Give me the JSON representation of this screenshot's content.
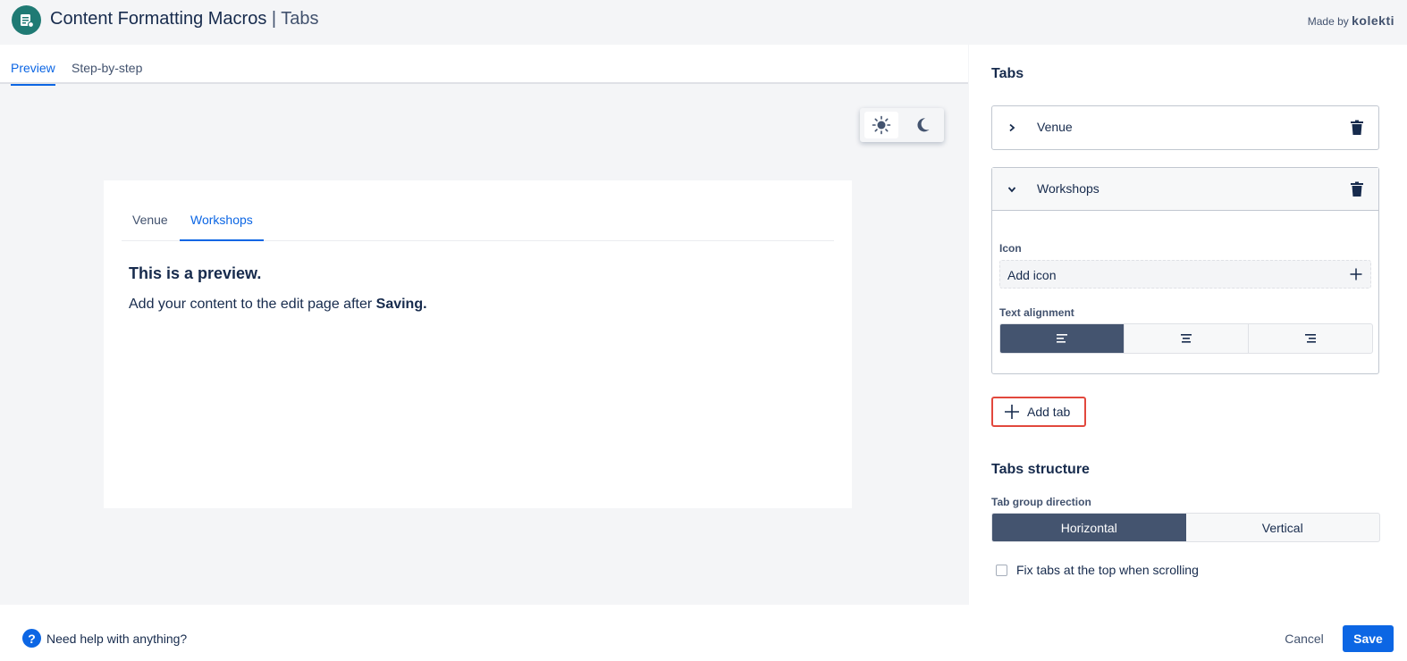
{
  "header": {
    "app_name": "Content Formatting Macros",
    "separator": " | ",
    "section": "Tabs",
    "made_by": "Made by",
    "brand": "kolekti"
  },
  "nav_tabs": [
    {
      "label": "Preview",
      "active": true
    },
    {
      "label": "Step-by-step",
      "active": false
    }
  ],
  "theme_toggle": {
    "options": [
      "sun-icon",
      "moon-icon"
    ],
    "selected": "light"
  },
  "preview": {
    "tabs": [
      {
        "label": "Venue",
        "active": false
      },
      {
        "label": "Workshops",
        "active": true
      }
    ],
    "heading": "This is a preview.",
    "body_prefix": "Add your content to the edit page after ",
    "body_bold": "Saving."
  },
  "panel": {
    "title": "Tabs",
    "items": [
      {
        "label": "Venue",
        "expanded": false
      },
      {
        "label": "Workshops",
        "expanded": true,
        "icon_label": "Icon",
        "add_icon": "Add icon",
        "text_alignment_label": "Text alignment",
        "alignment_options": [
          "align-left-icon",
          "align-center-icon",
          "align-right-icon"
        ],
        "alignment_selected": "left"
      }
    ],
    "add_tab": "Add tab",
    "structure_title": "Tabs structure",
    "direction_label": "Tab group direction",
    "direction_options": [
      "Horizontal",
      "Vertical"
    ],
    "direction_selected": "Horizontal",
    "fix_tabs_label": "Fix tabs at the top when scrolling",
    "fix_tabs_checked": false
  },
  "footer": {
    "help": "Need help with anything?",
    "cancel": "Cancel",
    "save": "Save"
  },
  "colors": {
    "accent": "#0c66e4",
    "selected_segment": "#44546f",
    "highlight_border": "#e2483d",
    "logo": "#1f7a74"
  }
}
